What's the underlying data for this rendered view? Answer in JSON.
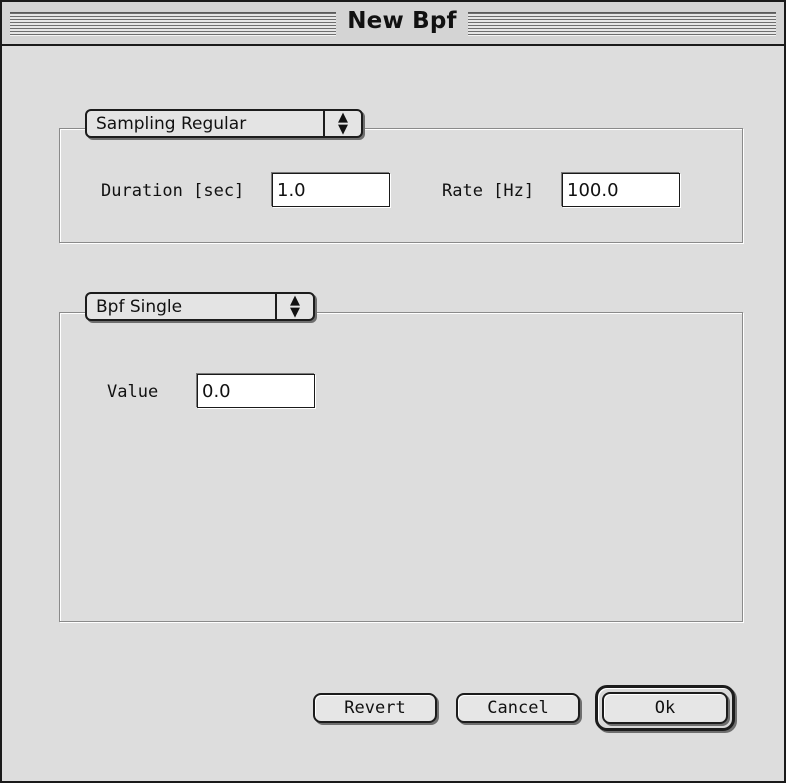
{
  "window": {
    "title": "New Bpf"
  },
  "sampling": {
    "mode": "Sampling Regular",
    "duration_label": "Duration [sec]",
    "duration_value": "1.0",
    "rate_label": "Rate [Hz]",
    "rate_value": "100.0"
  },
  "bpf": {
    "mode": "Bpf Single",
    "value_label": "Value",
    "value_value": "0.0"
  },
  "buttons": {
    "revert": "Revert",
    "cancel": "Cancel",
    "ok": "Ok"
  },
  "icons": {
    "popup_arrows": "updown-arrows-icon"
  },
  "colors": {
    "window_bg": "#dddddd",
    "field_bg": "#ffffff",
    "border": "#1a1a1a"
  }
}
